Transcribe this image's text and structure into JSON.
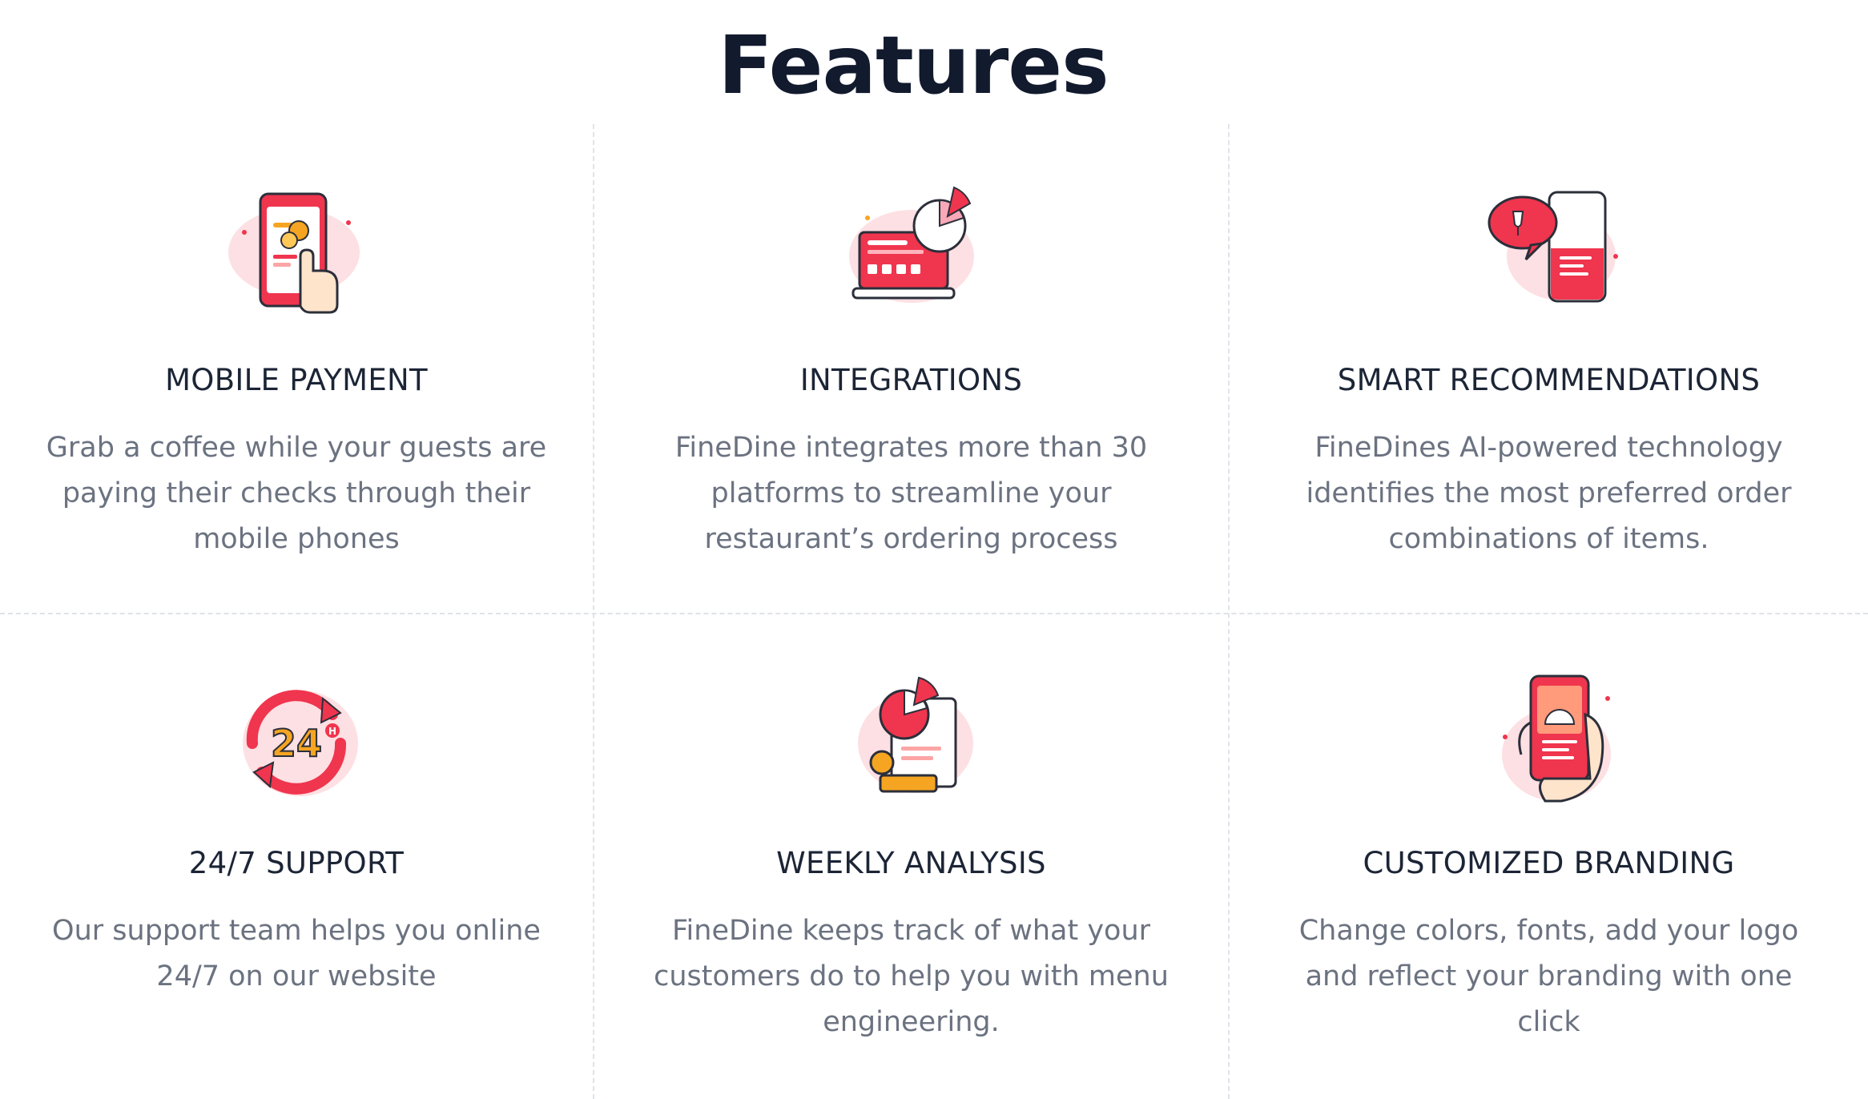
{
  "heading": "Features",
  "colors": {
    "primary": "#f0354e",
    "accent": "#ff6a63",
    "gold": "#f6a522",
    "pink_soft": "#fde0e3",
    "text_dark": "#1c2536",
    "text_muted": "#6b7280",
    "divider": "#dfe3ea"
  },
  "features": [
    {
      "icon": "mobile-payment-icon",
      "title": "MOBILE PAYMENT",
      "description": "Grab a coffee while your guests are paying their checks through their mobile phones"
    },
    {
      "icon": "integrations-icon",
      "title": "INTEGRATIONS",
      "description": "FineDine integrates more than 30 platforms to streamline your restaurant’s ordering process"
    },
    {
      "icon": "smart-recommendations-icon",
      "title": "SMART RECOMMENDATIONS",
      "description": "FineDines AI-powered technology identifies the most preferred order combinations of items."
    },
    {
      "icon": "support-24-7-icon",
      "title": "24/7 SUPPORT",
      "description": "Our support team helps you online 24/7 on our website"
    },
    {
      "icon": "weekly-analysis-icon",
      "title": "WEEKLY ANALYSIS",
      "description": "FineDine keeps track of what your customers do to help you with menu engineering."
    },
    {
      "icon": "customized-branding-icon",
      "title": "CUSTOMIZED BRANDING",
      "description": "Change colors, fonts, add your logo and reflect your branding with one click"
    }
  ],
  "icon_labels": {
    "support_24": "24",
    "support_h": "H"
  }
}
